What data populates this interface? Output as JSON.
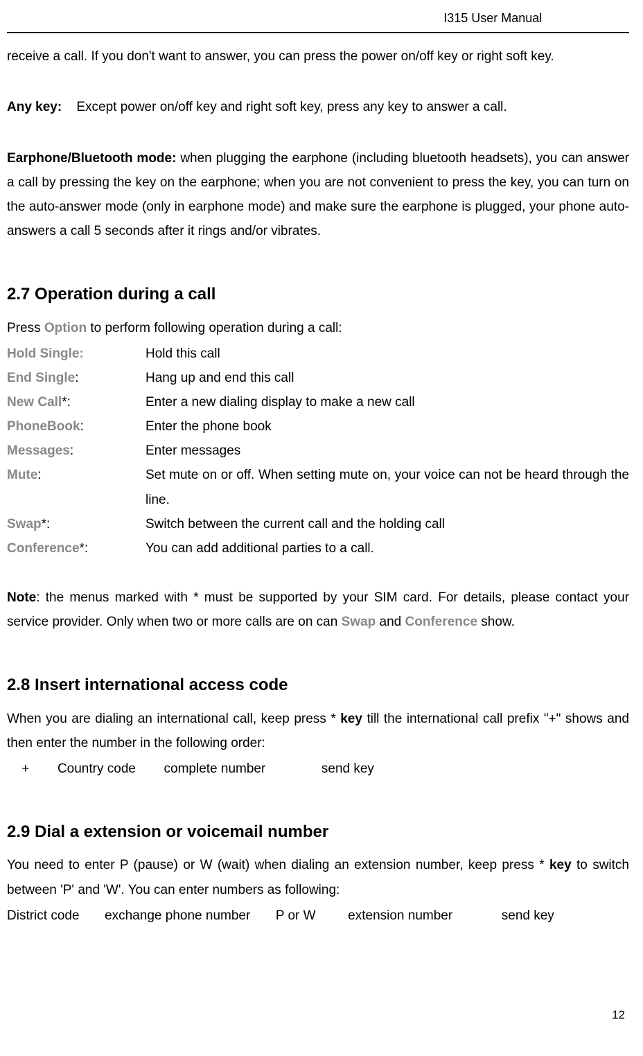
{
  "header": "I315 User Manual",
  "p1": "receive a call. If you don't want to answer, you can press the power on/off key or right soft key.",
  "p2_label": "Any key:",
  "p2_text": "Except power on/off key and right soft key, press any key to answer a call.",
  "p3_label": "Earphone/Bluetooth mode:",
  "p3_text": " when plugging the earphone (including bluetooth headsets), you can answer a call by pressing the key on the earphone; when you are not convenient to press the key, you can turn on the auto-answer mode (only in earphone mode) and make sure the earphone is plugged, your phone auto-answers a call 5 seconds after it rings and/or vibrates.",
  "sec27_title": "2.7 Operation during a call",
  "sec27_intro_pre": "Press ",
  "sec27_intro_bold": "Option",
  "sec27_intro_post": " to perform following operation during a call:",
  "ops": {
    "hold_label": "Hold Single:",
    "hold_desc": "Hold this call",
    "end_label": "End Single",
    "end_colon": ":",
    "end_desc": "Hang up and end this call",
    "newcall_label": "New Call",
    "newcall_star": "*:",
    "newcall_desc": "Enter a new dialing display to make a new call",
    "phonebook_label": "PhoneBook",
    "phonebook_desc": "Enter the phone book",
    "messages_label": "Messages",
    "messages_desc": "Enter messages",
    "mute_label": "Mute",
    "mute_desc": "Set mute on or off. When setting mute on, your voice can not be heard through the line.",
    "swap_label": "Swap",
    "swap_star": "*:",
    "swap_desc": "Switch between the current call and the holding call",
    "conf_label": "Conference",
    "conf_star": "*:",
    "conf_desc": "You can add additional parties to a call."
  },
  "note_label": "Note",
  "note_text_1": ": the menus marked with * must be supported by your SIM card. For details, please contact your service provider. Only when two or more calls are on can ",
  "note_swap": "Swap",
  "note_and": " and ",
  "note_conf": "Conference",
  "note_text_2": " show.",
  "sec28_title": "2.8 Insert international access code",
  "sec28_p1_pre": "When you are dialing an international call, keep press * ",
  "sec28_p1_key": "key",
  "sec28_p1_post": " till the international call prefix \"+\" shows and then enter the number in the following order:",
  "sec28_seq": {
    "a": "+",
    "b": "Country code",
    "c": "complete number",
    "d": "send key"
  },
  "sec29_title": "2.9 Dial a extension or voicemail number",
  "sec29_p1_pre": "You need to enter P (pause) or W (wait) when dialing an extension number, keep press * ",
  "sec29_p1_key": "key",
  "sec29_p1_post": " to switch between 'P' and 'W'. You can enter numbers as following:",
  "sec29_seq": {
    "a": "District code",
    "b": "exchange phone number",
    "c": "P or W",
    "d": "extension number",
    "e": "send key"
  },
  "page_number": "12"
}
